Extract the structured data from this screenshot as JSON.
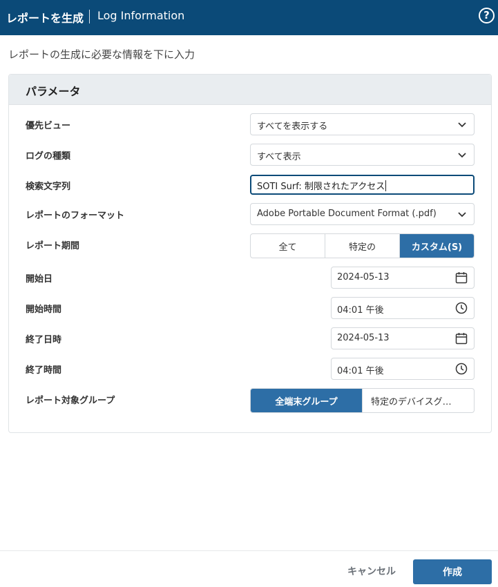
{
  "header": {
    "title": "レポートを生成",
    "subtitle": "Log Information",
    "help_icon": "question-circle-icon"
  },
  "instruction": "レポートの生成に必要な情報を下に入力",
  "panel": {
    "title": "パラメータ",
    "fields": {
      "preferred_view": {
        "label": "優先ビュー",
        "value": "すべてを表示する"
      },
      "log_type": {
        "label": "ログの種類",
        "value": "すべて表示"
      },
      "search_string": {
        "label": "検索文字列",
        "value": "SOTI Surf: 制限されたアクセス"
      },
      "report_format": {
        "label": "レポートのフォーマット",
        "value": "Adobe Portable Document Format (.pdf)"
      },
      "report_period": {
        "label": "レポート期間",
        "options": [
          "全て",
          "特定の",
          "カスタム(S)"
        ],
        "selected": "カスタム(S)"
      },
      "start_date": {
        "label": "開始日",
        "value": "2024-05-13",
        "icon": "calendar-icon"
      },
      "start_time": {
        "label": "開始時間",
        "value": "04:01 午後",
        "icon": "clock-icon"
      },
      "end_date": {
        "label": "終了日時",
        "value": "2024-05-13",
        "icon": "calendar-icon"
      },
      "end_time": {
        "label": "終了時間",
        "value": "04:01 午後",
        "icon": "clock-icon"
      },
      "target_group": {
        "label": "レポート対象グループ",
        "options": [
          "全端末グループ",
          "特定のデバイスグ…"
        ],
        "selected": "全端末グループ"
      }
    }
  },
  "footer": {
    "cancel_label": "キャンセル",
    "create_label": "作成"
  },
  "colors": {
    "header_bg": "#0b4a78",
    "accent": "#2d6ea6",
    "panel_head_bg": "#e9edf0"
  }
}
